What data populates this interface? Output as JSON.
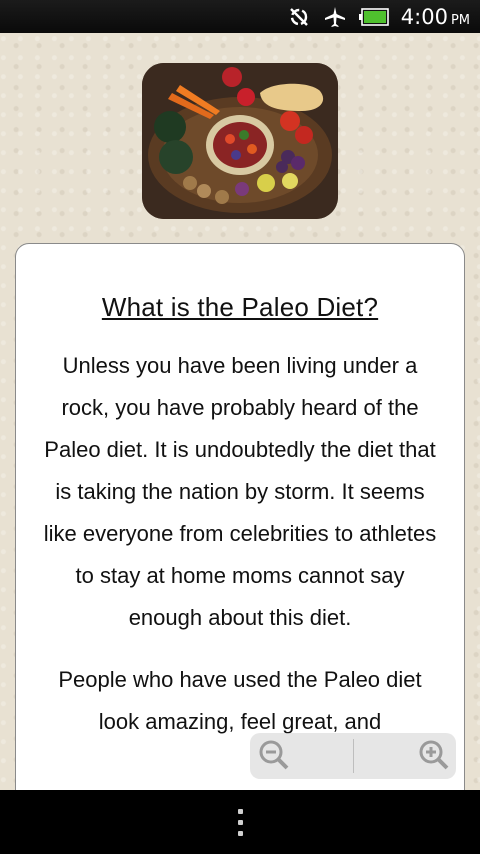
{
  "status_bar": {
    "time": "4:00",
    "ampm": "PM",
    "icons": [
      "sync-off-icon",
      "airplane-mode-icon",
      "battery-icon"
    ]
  },
  "article": {
    "image_alt": "basket of vegetables",
    "title": "What is the Paleo Diet?",
    "paragraphs": [
      "Unless you have been living under a rock, you have probably heard of the Paleo diet. It is undoubtedly the diet that is taking the nation by storm. It seems like everyone from celebrities to athletes to stay at home moms cannot say enough about this diet.",
      "People who have used the Paleo diet look amazing, feel great, and"
    ]
  },
  "zoom": {
    "out_icon": "zoom-out-icon",
    "in_icon": "zoom-in-icon"
  },
  "nav_bar": {
    "menu_icon": "menu-icon"
  }
}
